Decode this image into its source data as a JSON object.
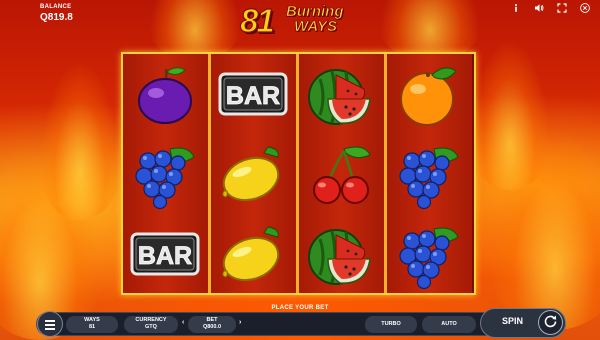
{
  "balance": {
    "label": "BALANCE",
    "value": "Q819.8"
  },
  "logo": {
    "number": "81",
    "word1": "Burning",
    "word2": "WAYS"
  },
  "top_icons": [
    "info-icon",
    "sound-icon",
    "fullscreen-icon",
    "close-icon"
  ],
  "reels": [
    [
      "plum",
      "grapes",
      "bar"
    ],
    [
      "bar",
      "lemon",
      "lemon"
    ],
    [
      "watermelon",
      "cherries",
      "watermelon"
    ],
    [
      "orange",
      "grapes",
      "grapes"
    ]
  ],
  "symbols": {
    "bar_text": "BAR"
  },
  "bottom": {
    "prompt": "PLACE YOUR BET",
    "ways_label": "WAYS",
    "ways_value": "81",
    "currency_label": "CURRENCY",
    "currency_value": "GTQ",
    "bet_label": "BET",
    "bet_value": "Q800.0",
    "bet_prev": "‹",
    "bet_next": "›",
    "turbo_label": "TURBO",
    "auto_label": "AUTO",
    "spin_label": "SPIN"
  },
  "colors": {
    "frame": "#ffd43b",
    "reel_bg": "#c4270a",
    "bar_bg": "#1a1f2b"
  }
}
